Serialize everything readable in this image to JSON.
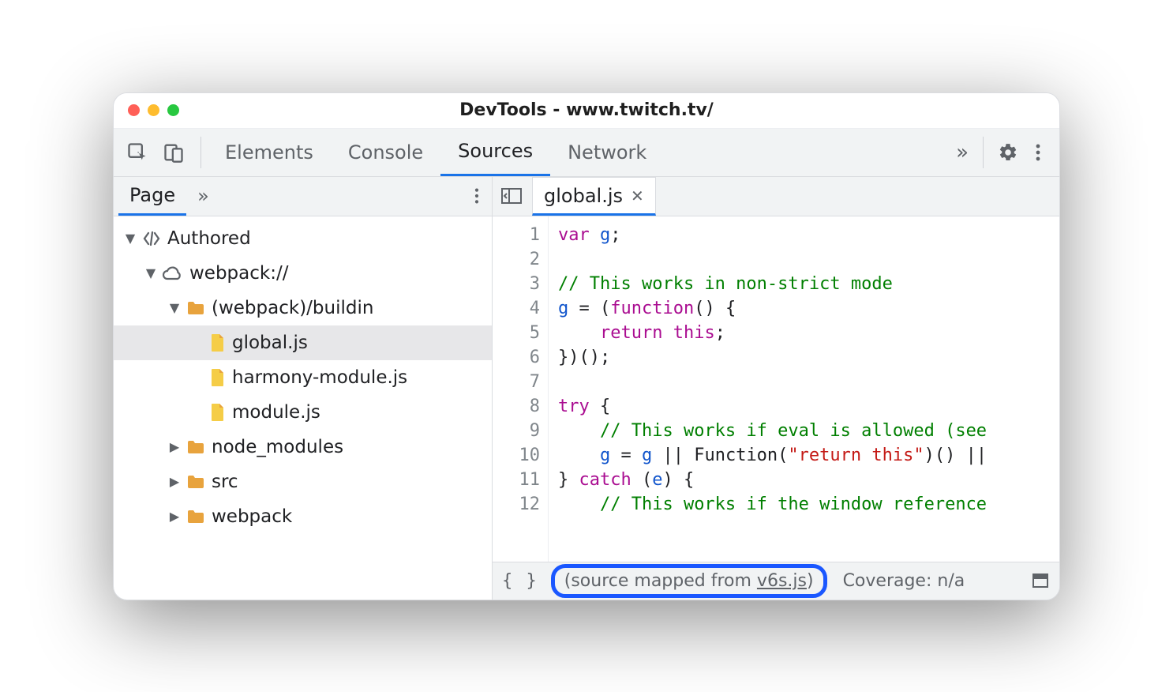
{
  "window": {
    "title": "DevTools - www.twitch.tv/"
  },
  "tabs": {
    "items": [
      "Elements",
      "Console",
      "Sources",
      "Network"
    ],
    "active_index": 2
  },
  "sidebar": {
    "active_tab": "Page",
    "tree": {
      "root_label": "Authored",
      "webpack_label": "webpack://",
      "buildin_label": "(webpack)/buildin",
      "files": [
        "global.js",
        "harmony-module.js",
        "module.js"
      ],
      "folders": [
        "node_modules",
        "src",
        "webpack"
      ],
      "selected_file": "global.js"
    }
  },
  "editor": {
    "open_tab": "global.js",
    "gutter": [
      "1",
      "2",
      "3",
      "4",
      "5",
      "6",
      "7",
      "8",
      "9",
      "10",
      "11",
      "12"
    ],
    "code_tokens": [
      [
        [
          "kw",
          "var"
        ],
        [
          "pn",
          " "
        ],
        [
          "id",
          "g"
        ],
        [
          "pn",
          ";"
        ]
      ],
      [],
      [
        [
          "cm",
          "// This works in non-strict mode"
        ]
      ],
      [
        [
          "id",
          "g"
        ],
        [
          "pn",
          " = ("
        ],
        [
          "fn",
          "function"
        ],
        [
          "pn",
          "() {"
        ]
      ],
      [
        [
          "pn",
          "    "
        ],
        [
          "kw",
          "return"
        ],
        [
          "pn",
          " "
        ],
        [
          "kw",
          "this"
        ],
        [
          "pn",
          ";"
        ]
      ],
      [
        [
          "pn",
          "})();"
        ]
      ],
      [],
      [
        [
          "kw",
          "try"
        ],
        [
          "pn",
          " {"
        ]
      ],
      [
        [
          "pn",
          "    "
        ],
        [
          "cm",
          "// This works if eval is allowed (see"
        ]
      ],
      [
        [
          "pn",
          "    "
        ],
        [
          "id",
          "g"
        ],
        [
          "pn",
          " = "
        ],
        [
          "id",
          "g"
        ],
        [
          "pn",
          " || Function("
        ],
        [
          "str",
          "\"return this\""
        ],
        [
          "pn",
          ")() ||"
        ]
      ],
      [
        [
          "pn",
          "} "
        ],
        [
          "kw",
          "catch"
        ],
        [
          "pn",
          " ("
        ],
        [
          "id",
          "e"
        ],
        [
          "pn",
          ") {"
        ]
      ],
      [
        [
          "pn",
          "    "
        ],
        [
          "cm",
          "// This works if the window reference"
        ]
      ]
    ]
  },
  "statusbar": {
    "source_map_prefix": "(source mapped from ",
    "source_map_file": "v6s.js",
    "source_map_suffix": ")",
    "coverage": "Coverage: n/a"
  }
}
